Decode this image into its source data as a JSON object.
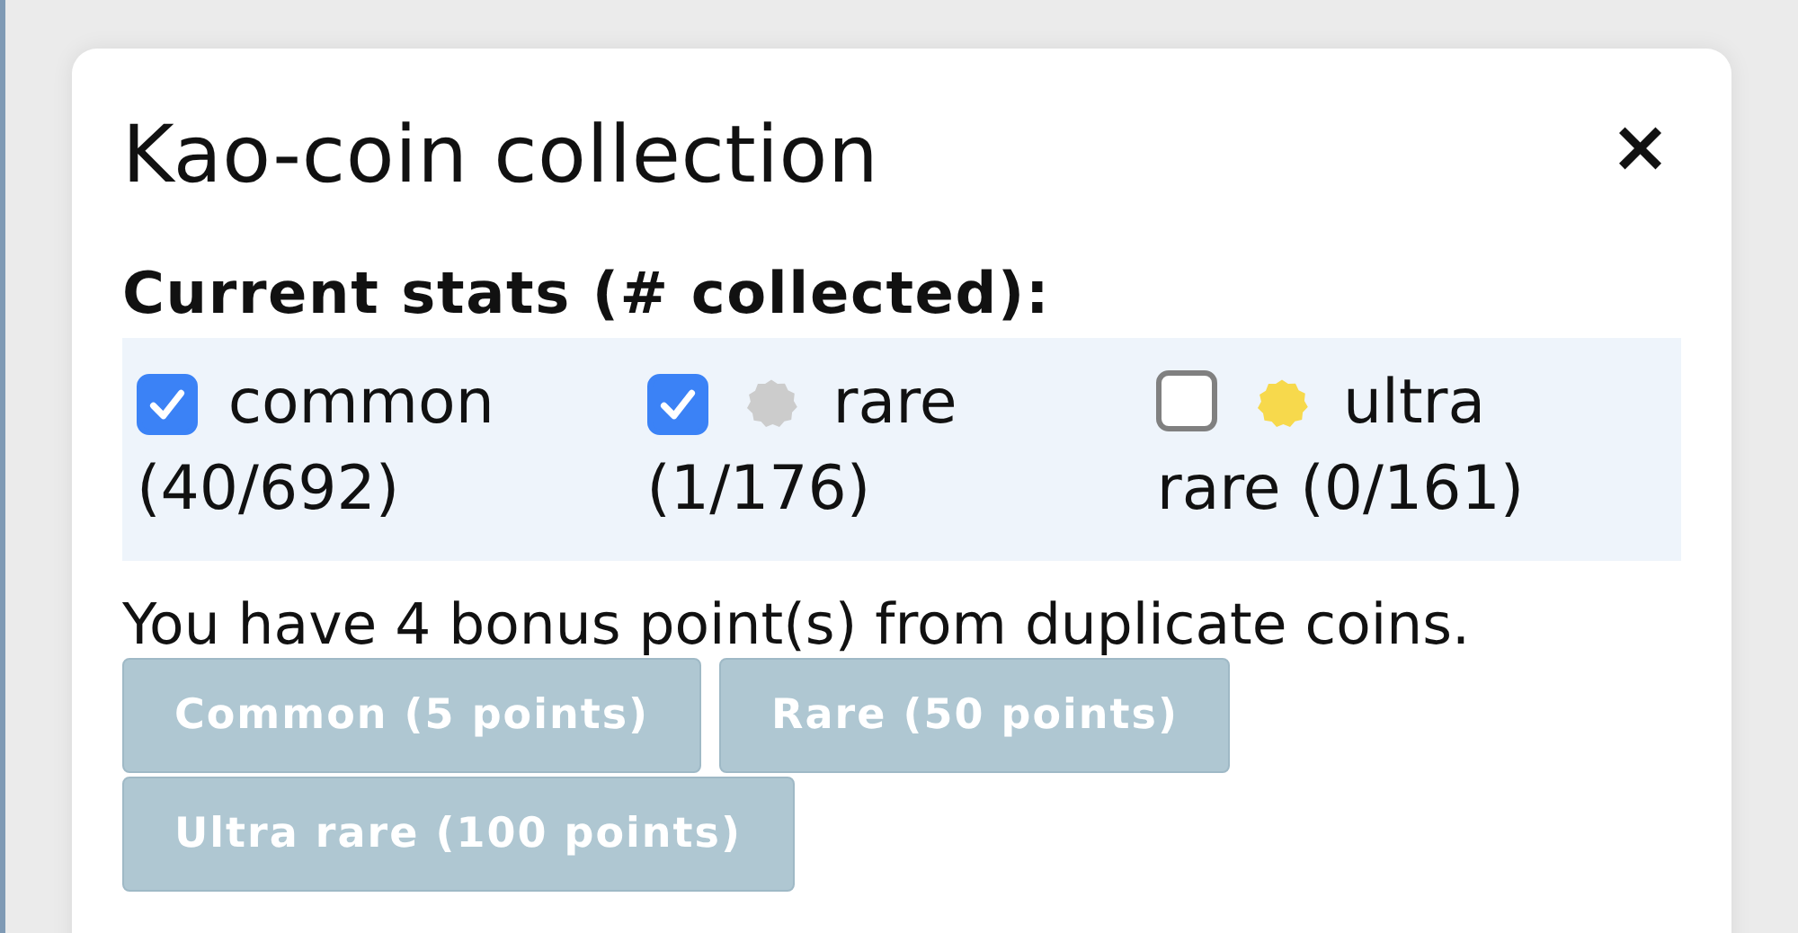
{
  "dialog": {
    "title": "Kao-coin collection",
    "close": "×"
  },
  "stats": {
    "heading": "Current stats (# collected):",
    "filters": [
      {
        "label": "common",
        "label_continued": "(40/692)",
        "checked": true
      },
      {
        "label": "rare",
        "label_continued": "(1/176)",
        "checked": true,
        "color": "#cccccc"
      },
      {
        "label": "ultra",
        "label_continued": "rare (0/161)",
        "checked": false,
        "color": "#f7d94c"
      }
    ]
  },
  "bonus_text": "You have 4 bonus point(s) from duplicate coins.",
  "buttons": [
    {
      "label": "Common (5 points)",
      "disabled": true
    },
    {
      "label": "Rare (50 points)",
      "disabled": true
    },
    {
      "label": "Ultra rare (100 points)",
      "disabled": true
    }
  ]
}
